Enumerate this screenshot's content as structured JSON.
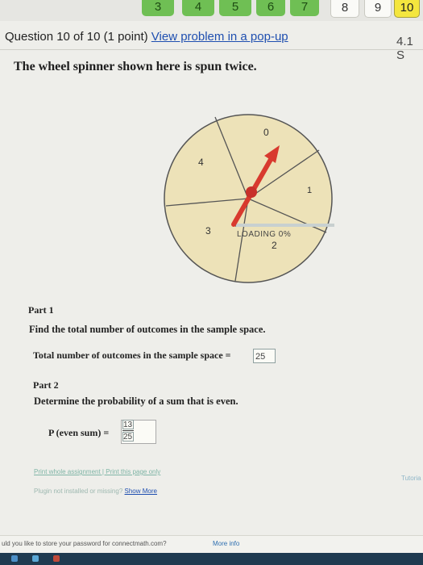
{
  "question_nav": {
    "items": [
      {
        "label": "3",
        "state": "done"
      },
      {
        "label": "4",
        "state": "done"
      },
      {
        "label": "5",
        "state": "done"
      },
      {
        "label": "6",
        "state": "done"
      },
      {
        "label": "7",
        "state": "done"
      },
      {
        "label": "8",
        "state": "open"
      },
      {
        "label": "9",
        "state": "open"
      },
      {
        "label": "10",
        "state": "current"
      }
    ]
  },
  "header": {
    "question_label": "Question 10 of 10 (1 point)",
    "popup_link": "View problem in a pop-up",
    "score_fragment": "4.1 S"
  },
  "question_text": "The wheel spinner shown here is spun twice.",
  "spinner": {
    "sections": [
      {
        "label": "0"
      },
      {
        "label": "1"
      },
      {
        "label": "2"
      },
      {
        "label": "3"
      },
      {
        "label": "4"
      }
    ],
    "loading_text": "LOADING 0%",
    "fill_color": "#ede2b8",
    "needle_color": "#d83a2e"
  },
  "part1": {
    "title": "Part 1",
    "question": "Find the total number of outcomes in the sample space.",
    "answer_label": "Total number of outcomes in the sample space =",
    "answer_value": "25"
  },
  "part2": {
    "title": "Part 2",
    "question": "Determine the probability of a sum that is even.",
    "answer_label": "P (even sum) =",
    "numerator": "13",
    "denominator": "25"
  },
  "footer": {
    "print_links": "Print whole assignment | Print this page only",
    "tutorial": "Tutoria",
    "plugin_text": "Plugin not installed or missing?",
    "show_more": "Show More"
  },
  "password_bar": {
    "text": "uld you like to store your password for connectmath.com?",
    "more_info": "More info"
  }
}
